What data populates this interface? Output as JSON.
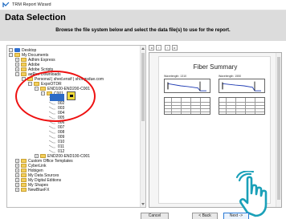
{
  "window": {
    "title": "TRM Report Wizard"
  },
  "header": {
    "title": "Data Selection",
    "subtitle": "Browse the file system below and select the data file(s) to use for the report."
  },
  "tree": {
    "items": [
      {
        "label": "Desktop",
        "icon": "monitor-icon"
      },
      {
        "label": "My Documents",
        "icon": "folder-icon"
      },
      {
        "label": "Adhim Express",
        "icon": "folder-icon"
      },
      {
        "label": "Adobe",
        "icon": "folder-icon"
      },
      {
        "label": "Adobe Scripts",
        "icon": "folder-icon"
      },
      {
        "label": "aeRox Downloads",
        "icon": "folder-icon"
      },
      {
        "label": "Personal | shed.ensif | shohgsdue.com",
        "icon": "folder-icon"
      },
      {
        "label": "ExpoOTDR",
        "icon": "folder-icon"
      },
      {
        "label": "END100-END200-C001",
        "icon": "folder-icon"
      },
      {
        "label": "C001",
        "icon": "folder-icon"
      },
      {
        "label": "001",
        "icon": "trace-file-icon"
      },
      {
        "label": "002",
        "icon": "trace-file-icon"
      },
      {
        "label": "003",
        "icon": "trace-file-icon"
      },
      {
        "label": "004",
        "icon": "trace-file-icon"
      },
      {
        "label": "005",
        "icon": "trace-file-icon"
      },
      {
        "label": "006",
        "icon": "trace-file-icon"
      },
      {
        "label": "007",
        "icon": "trace-file-icon"
      },
      {
        "label": "008",
        "icon": "trace-file-icon"
      },
      {
        "label": "009",
        "icon": "trace-file-icon"
      },
      {
        "label": "010",
        "icon": "trace-file-icon"
      },
      {
        "label": "011",
        "icon": "trace-file-icon"
      },
      {
        "label": "012",
        "icon": "trace-file-icon"
      },
      {
        "label": "END200-END100-C001",
        "icon": "folder-icon"
      },
      {
        "label": "Custom Office Templates",
        "icon": "folder-icon"
      },
      {
        "label": "CyberLink",
        "icon": "folder-icon"
      },
      {
        "label": "Hobigen",
        "icon": "folder-icon"
      },
      {
        "label": "My Data Sources",
        "icon": "folder-icon"
      },
      {
        "label": "My Digital Editions",
        "icon": "folder-icon"
      },
      {
        "label": "My Shapes",
        "icon": "folder-icon"
      },
      {
        "label": "NewBlueFX",
        "icon": "folder-icon"
      }
    ]
  },
  "preview": {
    "report_title": "Fiber Summary",
    "wavelength_left": "Wavelength: 1310",
    "wavelength_right": "Wavelength: 1550"
  },
  "footer": {
    "cancel_label": "Cancel",
    "back_label": "< Back",
    "next_label": "Next ->"
  },
  "colors": {
    "header_bg": "#dcdcdc",
    "highlight_ellipse": "#e11111",
    "selection": "#2d6bc6",
    "pointer_hand": "#1aa0b8"
  }
}
